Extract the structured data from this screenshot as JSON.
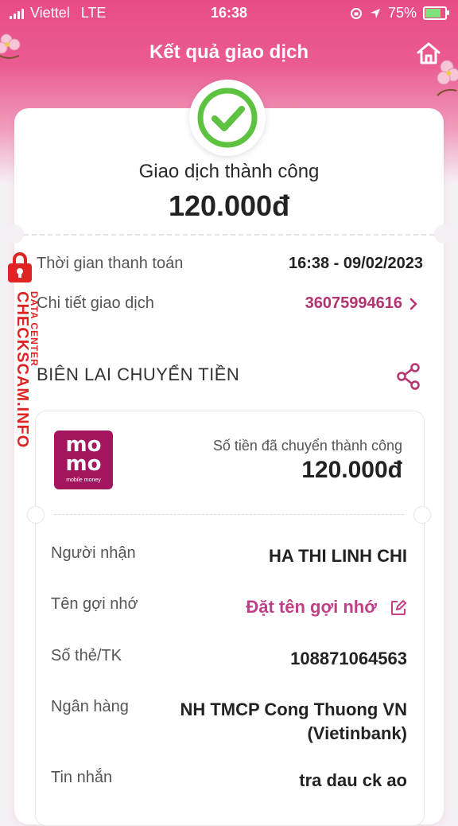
{
  "status_bar": {
    "carrier": "Viettel",
    "network": "LTE",
    "time": "16:38",
    "battery": "75%"
  },
  "header": {
    "title": "Kết quả giao dịch"
  },
  "result": {
    "status": "Giao dịch thành công",
    "amount": "120.000đ"
  },
  "summary": [
    {
      "label": "Thời gian thanh toán",
      "value": "16:38 - 09/02/2023"
    },
    {
      "label": "Chi tiết giao dịch",
      "value": "36075994616"
    }
  ],
  "receipt": {
    "section_title": "BIÊN LAI CHUYỂN TIỀN",
    "logo_line1": "mo",
    "logo_line2": "mo",
    "logo_sub": "mobile money",
    "label": "Số tiền đã chuyển thành công",
    "amount": "120.000đ",
    "details": [
      {
        "label": "Người nhận",
        "value": "HA THI LINH CHI"
      },
      {
        "label": "Tên gợi nhớ",
        "value": "Đặt tên gợi nhớ"
      },
      {
        "label": "Số thẻ/TK",
        "value": "108871064563"
      },
      {
        "label": "Ngân hàng",
        "value": "NH TMCP Cong Thuong VN (Vietinbank)"
      },
      {
        "label": "Tin nhắn",
        "value": "tra dau ck ao"
      }
    ]
  },
  "watermark": {
    "main": "CHECKSCAM.INFO",
    "sub": "DATA CENTER"
  },
  "colors": {
    "header_pink": "#e84c86",
    "accent_pink": "#b3336f",
    "success_green": "#5cc23f",
    "watermark_red": "#e02424"
  },
  "icons": {
    "home": "home-icon",
    "check": "check-circle-icon",
    "share": "share-icon",
    "edit": "edit-icon",
    "chevron": "chevron-right-icon"
  }
}
